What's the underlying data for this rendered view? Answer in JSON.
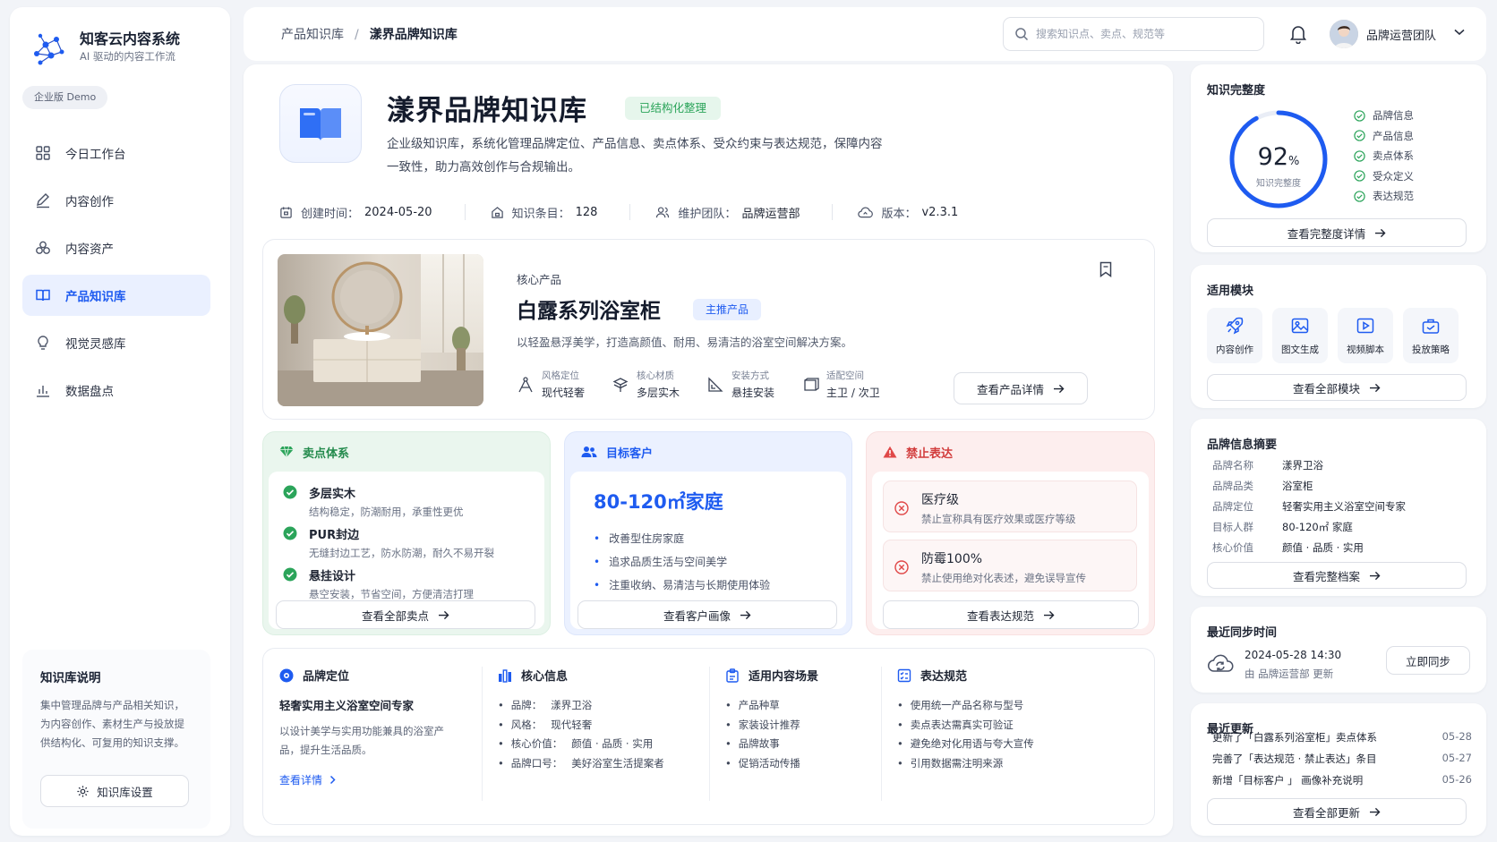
{
  "sidebar": {
    "brand_name": "知客云内容系统",
    "brand_sub": "AI 驱动的内容工作流",
    "edition": "企业版 Demo",
    "items": [
      {
        "label": "今日工作台",
        "icon": "grid-icon"
      },
      {
        "label": "内容创作",
        "icon": "pen-icon"
      },
      {
        "label": "内容资产",
        "icon": "assets-icon"
      },
      {
        "label": "产品知识库",
        "icon": "book-icon",
        "active": true
      },
      {
        "label": "视觉灵感库",
        "icon": "lightbulb-icon"
      },
      {
        "label": "数据盘点",
        "icon": "bar-chart-icon"
      }
    ],
    "note_title": "知识库说明",
    "note_text": "集中管理品牌与产品相关知识，为内容创作、素材生产与投放提供结构化、可复用的知识支撑。",
    "settings_label": "知识库设置"
  },
  "topbar": {
    "crumb_parent": "产品知识库",
    "crumb_sep": "/",
    "crumb_current": "漾界品牌知识库",
    "search_placeholder": "搜索知识点、卖点、规范等",
    "user_name": "品牌运营团队"
  },
  "hero": {
    "title": "漾界品牌知识库",
    "badge": "已结构化整理",
    "desc": "企业级知识库，系统化管理品牌定位、产品信息、卖点体系、受众约束与表达规范，保障内容一致性，助力高效创作与合规输出。",
    "meta": [
      {
        "label": "创建时间：",
        "value": "2024-05-20"
      },
      {
        "label": "知识条目：",
        "value": "128"
      },
      {
        "label": "维护团队：",
        "value": "品牌运营部"
      },
      {
        "label": "版本：",
        "value": "v2.3.1"
      }
    ]
  },
  "product": {
    "tag": "核心产品",
    "title": "白露系列浴室柜",
    "badge": "主推产品",
    "desc": "以轻盈悬浮美学，打造高颜值、耐用、易清洁的浴室空间解决方案。",
    "attrs": [
      {
        "k": "风格定位",
        "v": "现代轻奢"
      },
      {
        "k": "核心材质",
        "v": "多层实木"
      },
      {
        "k": "安装方式",
        "v": "悬挂安装"
      },
      {
        "k": "适配空间",
        "v": "主卫 / 次卫"
      }
    ],
    "detail_btn": "查看产品详情"
  },
  "selling": {
    "title": "卖点体系",
    "items": [
      {
        "t": "多层实木",
        "d": "结构稳定，防潮耐用，承重性更优"
      },
      {
        "t": "PUR封边",
        "d": "无缝封边工艺，防水防潮，耐久不易开裂"
      },
      {
        "t": "悬挂设计",
        "d": "悬空安装，节省空间，方便清洁打理"
      }
    ],
    "btn": "查看全部卖点"
  },
  "customer": {
    "title": "目标客户",
    "headline": "80-120㎡家庭",
    "items": [
      "改善型住房家庭",
      "追求品质生活与空间美学",
      "注重收纳、易清洁与长期使用体验"
    ],
    "btn": "查看客户画像"
  },
  "forbidden": {
    "title": "禁止表达",
    "items": [
      {
        "t": "医疗级",
        "d": "禁止宣称具有医疗效果或医疗等级"
      },
      {
        "t": "防霉100%",
        "d": "禁止使用绝对化表述，避免误导宣传"
      }
    ],
    "btn": "查看表达规范"
  },
  "info": {
    "positioning": {
      "title": "品牌定位",
      "strong": "轻奢实用主义浴室空间专家",
      "desc": "以设计美学与实用功能兼具的浴室产品，提升生活品质。",
      "link": "查看详情"
    },
    "core": {
      "title": "核心信息",
      "items": [
        {
          "k": "品牌：",
          "v": "漾界卫浴"
        },
        {
          "k": "风格：",
          "v": "现代轻奢"
        },
        {
          "k": "核心价值：",
          "v": "颜值 · 品质 · 实用"
        },
        {
          "k": "品牌口号：",
          "v": "美好浴室生活提案者"
        }
      ]
    },
    "scenes": {
      "title": "适用内容场景",
      "items": [
        "产品种草",
        "家装设计推荐",
        "品牌故事",
        "促销活动传播"
      ]
    },
    "rules": {
      "title": "表达规范",
      "items": [
        "使用统一产品名称与型号",
        "卖点表达需真实可验证",
        "避免绝对化用语与夸大宣传",
        "引用数据需注明来源"
      ]
    }
  },
  "completeness": {
    "title": "知识完整度",
    "percent": 92,
    "value_text": "92",
    "unit": "%",
    "label": "知识完整度",
    "checks": [
      "品牌信息",
      "产品信息",
      "卖点体系",
      "受众定义",
      "表达规范"
    ],
    "btn": "查看完整度详情"
  },
  "modules": {
    "title": "适用模块",
    "items": [
      {
        "label": "内容创作",
        "icon": "rocket-icon"
      },
      {
        "label": "图文生成",
        "icon": "image-icon"
      },
      {
        "label": "视频脚本",
        "icon": "video-icon"
      },
      {
        "label": "投放策略",
        "icon": "briefcase-icon"
      }
    ],
    "btn": "查看全部模块"
  },
  "brand_summary": {
    "title": "品牌信息摘要",
    "rows": [
      {
        "k": "品牌名称",
        "v": "漾界卫浴"
      },
      {
        "k": "品牌品类",
        "v": "浴室柜"
      },
      {
        "k": "品牌定位",
        "v": "轻奢实用主义浴室空间专家"
      },
      {
        "k": "目标人群",
        "v": "80-120㎡ 家庭"
      },
      {
        "k": "核心价值",
        "v": "颜值 · 品质 · 实用"
      }
    ],
    "btn": "查看完整档案"
  },
  "sync": {
    "title": "最近同步时间",
    "time": "2024-05-28 14:30",
    "by": "由 品牌运营部 更新",
    "btn": "立即同步"
  },
  "updates": {
    "title": "最近更新",
    "items": [
      {
        "t": "更新了「白露系列浴室柜」卖点体系",
        "d": "05-28"
      },
      {
        "t": "完善了「表达规范 · 禁止表达」条目",
        "d": "05-27"
      },
      {
        "t": "新增「目标客户 」 画像补充说明",
        "d": "05-26"
      }
    ],
    "btn": "查看全部更新"
  },
  "colors": {
    "primary": "#1e5bf0",
    "success": "#2ba45a",
    "danger": "#e04848",
    "page_bg": "#f2f4f8"
  }
}
